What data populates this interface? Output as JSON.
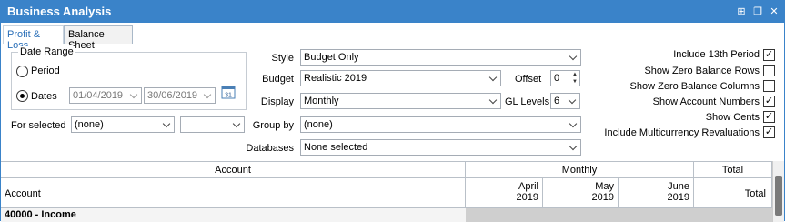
{
  "window": {
    "title": "Business Analysis",
    "controls": {
      "pin": "⊞",
      "restore": "❐",
      "close": "✕"
    }
  },
  "tabs": [
    {
      "label": "Profit & Loss",
      "active": true
    },
    {
      "label": "Balance Sheet",
      "active": false
    }
  ],
  "date_range": {
    "group_label": "Date Range",
    "period_label": "Period",
    "dates_label": "Dates",
    "selected": "dates",
    "from": "01/04/2019",
    "to": "30/06/2019",
    "calendar_day": "31"
  },
  "for_selected": {
    "label": "For selected",
    "value": "(none)",
    "value2": ""
  },
  "style": {
    "label": "Style",
    "value": "Budget Only"
  },
  "budget": {
    "label": "Budget",
    "value": "Realistic 2019"
  },
  "offset": {
    "label": "Offset",
    "value": "0"
  },
  "display": {
    "label": "Display",
    "value": "Monthly"
  },
  "gl_levels": {
    "label": "GL Levels",
    "value": "6"
  },
  "group_by": {
    "label": "Group by",
    "value": "(none)"
  },
  "databases": {
    "label": "Databases",
    "value": "None selected"
  },
  "options": [
    {
      "label": "Include 13th Period",
      "checked": true
    },
    {
      "label": "Show Zero Balance Rows",
      "checked": false
    },
    {
      "label": "Show Zero Balance Columns",
      "checked": false
    },
    {
      "label": "Show Account Numbers",
      "checked": true
    },
    {
      "label": "Show Cents",
      "checked": true
    },
    {
      "label": "Include Multicurrency Revaluations",
      "checked": true
    }
  ],
  "grid": {
    "band_account": "Account",
    "band_monthly": "Monthly",
    "band_total": "Total",
    "col_account": "Account",
    "col_april_1": "April",
    "col_april_2": "2019",
    "col_may_1": "May",
    "col_may_2": "2019",
    "col_june_1": "June",
    "col_june_2": "2019",
    "col_total": "Total",
    "row1": "40000 - Income"
  }
}
